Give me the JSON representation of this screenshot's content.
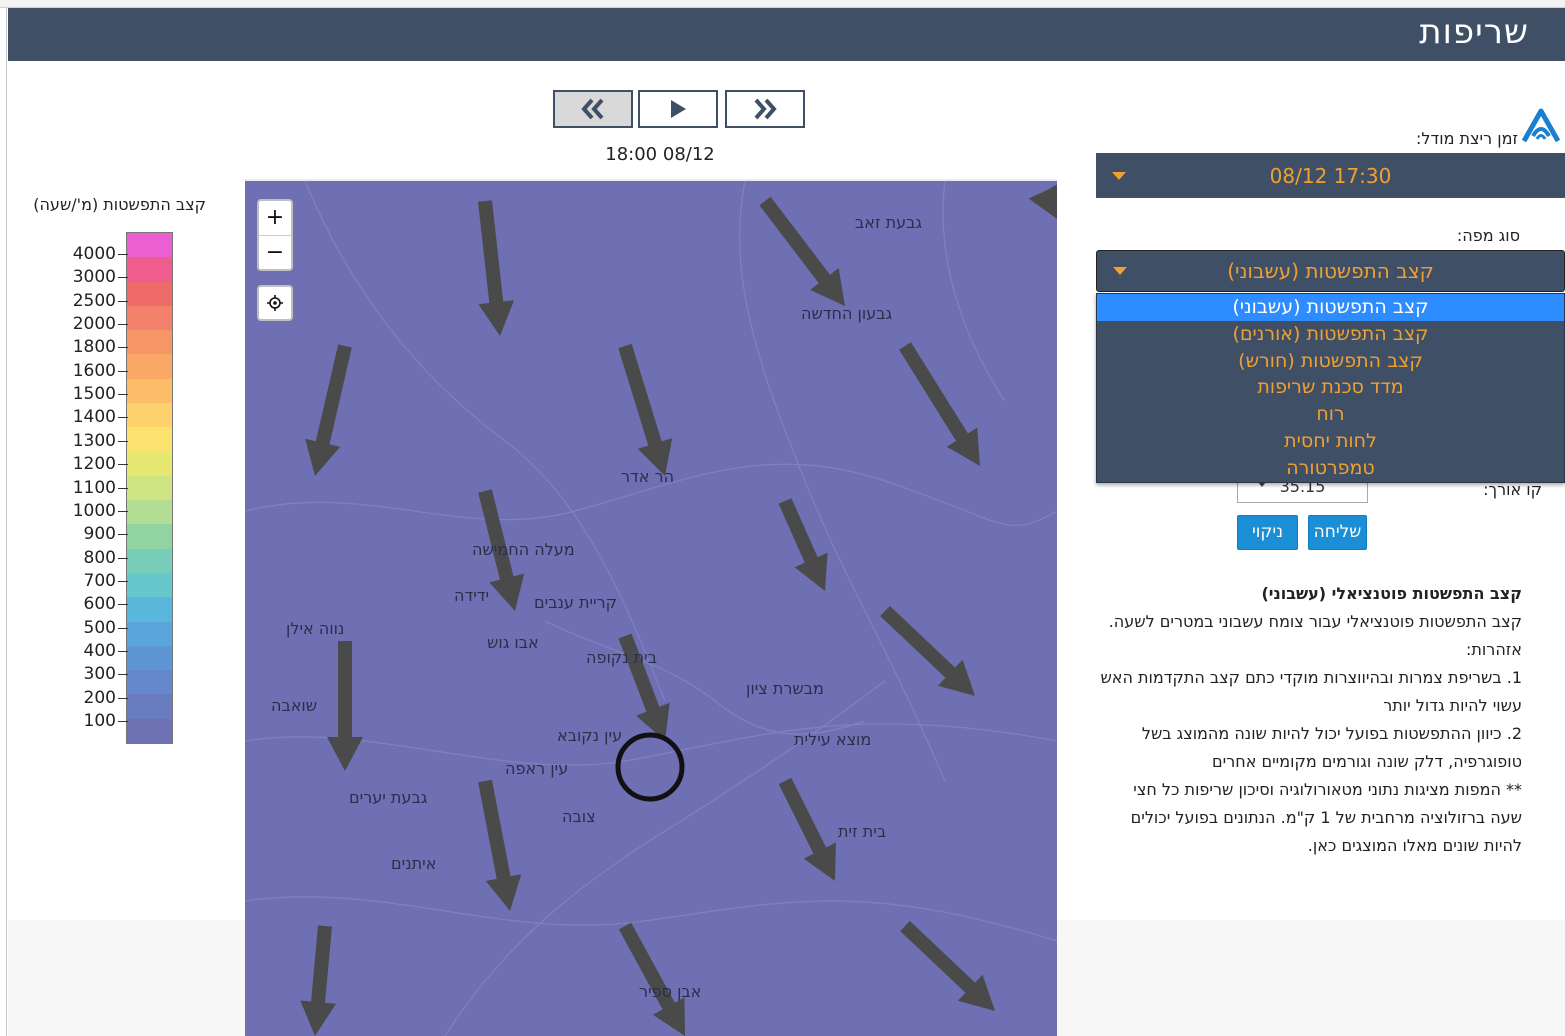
{
  "header": {
    "title": "שריפות"
  },
  "playback": {
    "timestamp": "18:00 08/12"
  },
  "legend": {
    "title": "קצב התפשטות (מ'/שעה)",
    "labels": [
      "4000",
      "3000",
      "2500",
      "2000",
      "1800",
      "1600",
      "1500",
      "1400",
      "1300",
      "1200",
      "1100",
      "1000",
      "900",
      "800",
      "700",
      "600",
      "500",
      "400",
      "300",
      "200",
      "100"
    ],
    "colors": [
      "#ec5fd2",
      "#ef5c8e",
      "#ef6b6a",
      "#f2806a",
      "#f69666",
      "#f9a865",
      "#fbbd68",
      "#fdd16c",
      "#fbe26e",
      "#e7e872",
      "#cfe584",
      "#b2de93",
      "#92d3a2",
      "#77cdb8",
      "#66c7cc",
      "#58b7da",
      "#5aa5dc",
      "#5e95d4",
      "#6587cb",
      "#6a7cc0",
      "#6e72b4"
    ]
  },
  "map": {
    "zoom_in": "+",
    "zoom_out": "−",
    "places": [
      "גבעת זאב",
      "גבעון החדשה",
      "הר אדר",
      "מעלה החמישה",
      "ידידה",
      "קריית ענבים",
      "נווה אילן",
      "אבו גוש",
      "בית נקופה",
      "מבשרת ציון",
      "שואבה",
      "עין נקובא",
      "מוצא עילית",
      "עין ראפה",
      "גבעת יערים",
      "צובה",
      "בית זית",
      "איתנים",
      "אבן ספיר"
    ]
  },
  "panel": {
    "model_time_label": "זמן ריצת מודל:",
    "model_time_value": "17:30 08/12",
    "map_type_label": "סוג מפה:",
    "map_type_value": "קצב התפשטות (עשבוני)",
    "map_type_options": [
      "קצב התפשטות (עשבוני)",
      "קצב התפשטות (אורנים)",
      "קצב התפשטות (חורש)",
      "מדד סכנת שריפות",
      "רוח",
      "לחות יחסית",
      "טמפרטורה"
    ],
    "longitude_label": "קו אורך:",
    "longitude_value": "35.15",
    "send_button": "שליחה",
    "clear_button": "ניקוי"
  },
  "description": {
    "heading": "קצב התפשטות פוטנציאלי (עשבוני)",
    "body": "קצב התפשטות פוטנציאלי עבור צומח עשבוני במטרים לשעה.",
    "warnings_label": "אזהרות:",
    "warning1": "1. בשריפת צמרות ובהיווצרות מוקדי כתם קצב התקדמות האש עשוי להיות גדול יותר",
    "warning2": "2. כיוון ההתפשטות בפועל יכול להיות שונה מהמוצג בשל טופוגרפיה, דלק שונה וגורמים מקומיים אחרים",
    "note": "** המפות מציגות נתוני מטאורולוגיה וסיכון שריפות כל חצי שעה ברזולוציה מרחבית של 1 ק\"מ. הנתונים בפועל יכולים להיות שונים מאלו המוצגים כאן."
  },
  "colors": {
    "header_bg": "#3f5066",
    "accent": "#f0a030",
    "selected": "#2d8cff",
    "map_bg": "#6e70b3"
  }
}
